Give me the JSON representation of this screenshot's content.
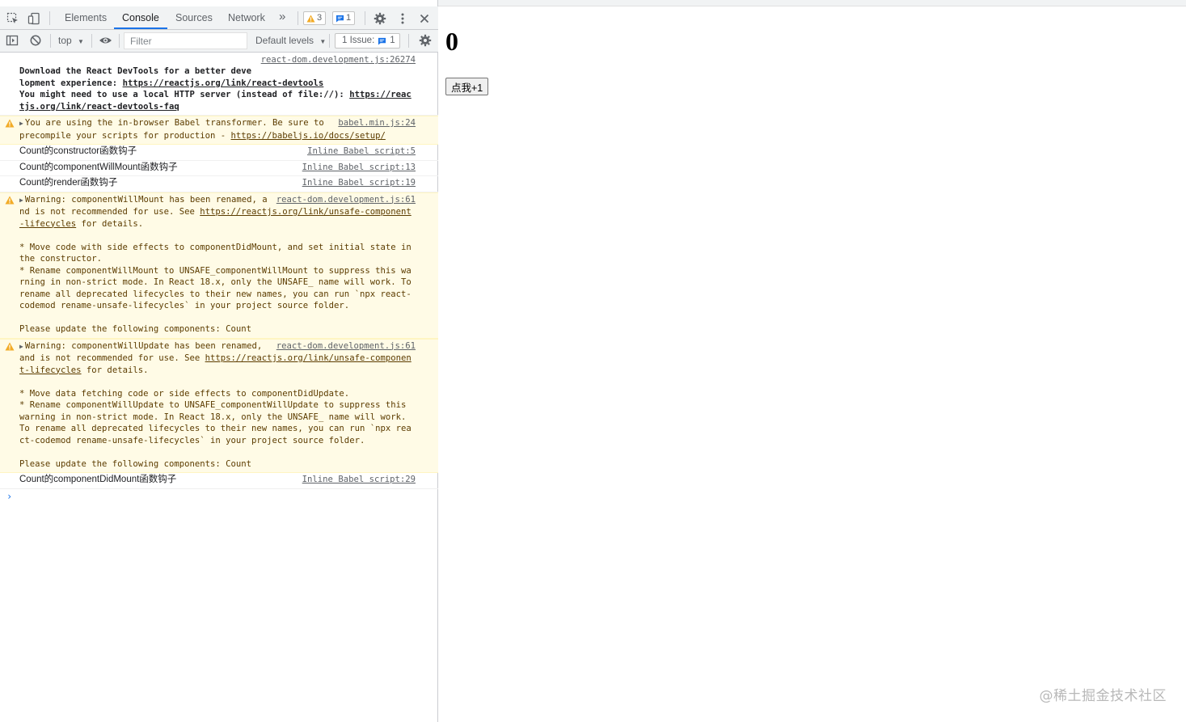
{
  "devtools": {
    "tabs": [
      "Elements",
      "Console",
      "Sources",
      "Network"
    ],
    "active_tab": "Console",
    "more_tabs_icon": "chevron-double-right-icon",
    "warnings_count": "3",
    "messages_count": "1",
    "filterbar": {
      "context": "top",
      "filter_placeholder": "Filter",
      "levels": "Default levels",
      "issues_label": "1 Issue:",
      "issues_count": "1"
    },
    "console": {
      "m1": {
        "source": "react-dom.development.js:26274",
        "line1_prefix": "Download the React DevTools for a better development experience: ",
        "line1_link": "https://reactjs.org/link/react-devtools",
        "line2_prefix": "You might need to use a local HTTP server (instead of file://): ",
        "line2_link": "https://reactjs.org/link/react-devtools-faq"
      },
      "m2": {
        "source": "babel.min.js:24",
        "text": "You are using the in-browser Babel transformer. Be sure to precompile your scripts for production - ",
        "link": "https://babeljs.io/docs/setup/"
      },
      "m3": {
        "text": "Count的constructor函数钩子",
        "source": "Inline Babel script:5"
      },
      "m4": {
        "text": "Count的componentWillMount函数钩子",
        "source": "Inline Babel script:13"
      },
      "m5": {
        "text": "Count的render函数钩子",
        "source": "Inline Babel script:19"
      },
      "m6": {
        "source": "react-dom.development.js:61",
        "text_a": "Warning: componentWillMount has been renamed, and is not recommended for use. See ",
        "link": "https://reactjs.org/link/unsafe-component-lifecycles",
        "text_b": " for details.\n\n* Move code with side effects to componentDidMount, and set initial state in the constructor.\n* Rename componentWillMount to UNSAFE_componentWillMount to suppress this warning in non-strict mode. In React 18.x, only the UNSAFE_ name will work. To rename all deprecated lifecycles to their new names, you can run `npx react-codemod rename-unsafe-lifecycles` in your project source folder.\n\nPlease update the following components: Count"
      },
      "m7": {
        "source": "react-dom.development.js:61",
        "text_a": "Warning: componentWillUpdate has been renamed, and is not recommended for use. See ",
        "link": "https://reactjs.org/link/unsafe-component-lifecycles",
        "text_b": " for details.\n\n* Move data fetching code or side effects to componentDidUpdate.\n* Rename componentWillUpdate to UNSAFE_componentWillUpdate to suppress this warning in non-strict mode. In React 18.x, only the UNSAFE_ name will work. To rename all deprecated lifecycles to their new names, you can run `npx react-codemod rename-unsafe-lifecycles` in your project source folder.\n\nPlease update the following components: Count"
      },
      "m8": {
        "text": "Count的componentDidMount函数钩子",
        "source": "Inline Babel script:29"
      },
      "prompt": "›"
    }
  },
  "page": {
    "count": "0",
    "button_label": "点我+1",
    "watermark": "@稀土掘金技术社区"
  },
  "colors": {
    "accent": "#1a73e8",
    "warning_bg": "#fffbe6",
    "warning_icon": "#f2ab26",
    "toolbar_bg": "#f1f3f4"
  }
}
